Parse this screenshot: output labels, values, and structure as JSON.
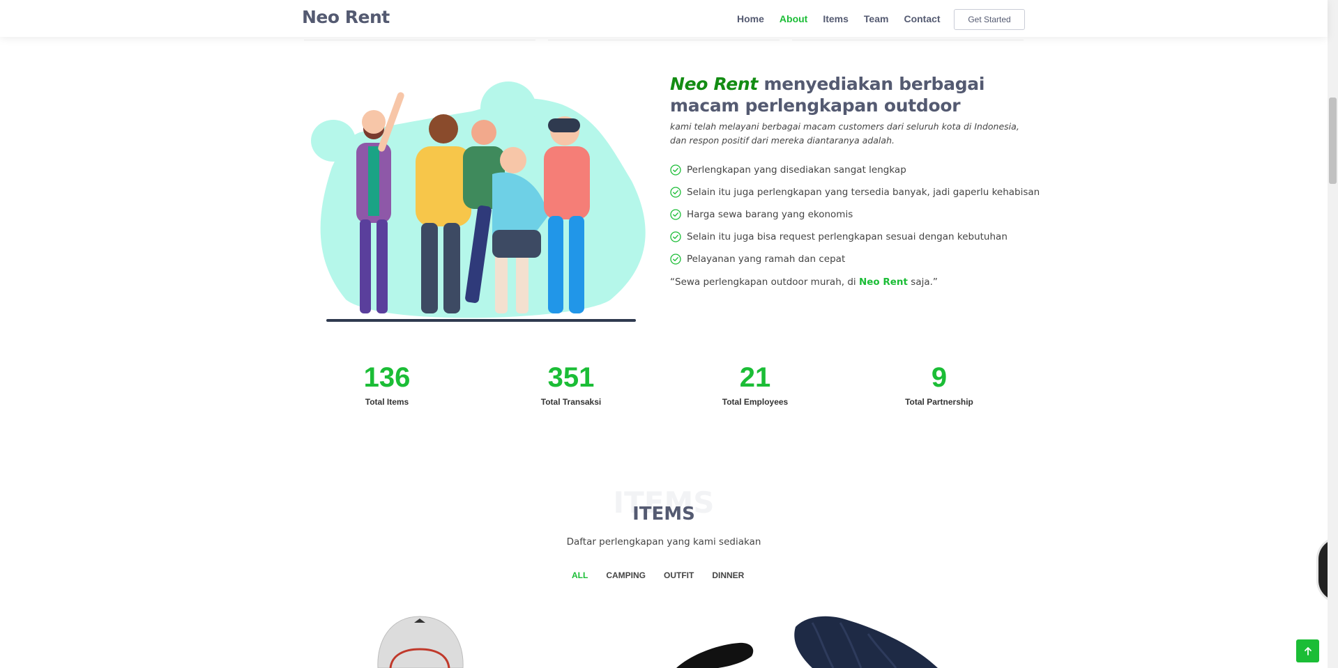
{
  "header": {
    "logo": "Neo Rent",
    "nav": [
      {
        "label": "Home",
        "active": false
      },
      {
        "label": "About",
        "active": true
      },
      {
        "label": "Items",
        "active": false
      },
      {
        "label": "Team",
        "active": false
      },
      {
        "label": "Contact",
        "active": false
      }
    ],
    "cta_label": "Get Started"
  },
  "about": {
    "brand": "Neo Rent",
    "title_rest": " menyediakan berbagai macam perlengkapan outdoor",
    "lead": "kami telah melayani berbagai macam customers dari seluruh kota di Indonesia, dan respon positif dari mereka diantaranya adalah.",
    "points": [
      "Perlengkapan yang disediakan sangat lengkap",
      "Selain itu juga perlengkapan yang tersedia banyak, jadi gaperlu kehabisan",
      "Harga sewa barang yang ekonomis",
      "Selain itu juga bisa request perlengkapan sesuai dengan kebutuhan",
      "Pelayanan yang ramah dan cepat"
    ],
    "quote_prefix": "“Sewa perlengkapan outdoor murah, di ",
    "quote_brand": "Neo Rent",
    "quote_suffix": " saja.”"
  },
  "stats": [
    {
      "value": "136",
      "label": "Total Items"
    },
    {
      "value": "351",
      "label": "Total Transaksi"
    },
    {
      "value": "21",
      "label": "Total Employees"
    },
    {
      "value": "9",
      "label": "Total Partnership"
    }
  ],
  "items_section": {
    "bg_title": "ITEMS",
    "title": "ITEMS",
    "subtitle": "Daftar perlengkapan yang kami sediakan",
    "filters": [
      {
        "label": "ALL",
        "active": true
      },
      {
        "label": "CAMPING",
        "active": false
      },
      {
        "label": "OUTFIT",
        "active": false
      },
      {
        "label": "DINNER",
        "active": false
      }
    ]
  },
  "colors": {
    "accent": "#1bbd36",
    "brand_dark_green": "#138c13",
    "heading": "#545a71",
    "illustration_blob": "#b5f7ea"
  },
  "icons": {
    "check": "check-circle-icon",
    "back_to_top": "arrow-up-icon"
  }
}
